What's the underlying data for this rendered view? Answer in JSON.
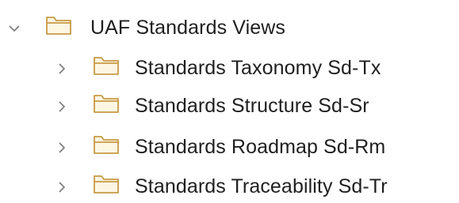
{
  "tree": {
    "root": {
      "label": "UAF Standards Views",
      "expanded": true,
      "icon": "folder-icon",
      "expand_icon": "chevron-down-icon"
    },
    "children": [
      {
        "label": "Standards Taxonomy Sd-Tx",
        "expanded": false,
        "icon": "folder-icon",
        "expand_icon": "chevron-right-icon"
      },
      {
        "label": "Standards Structure Sd-Sr",
        "expanded": false,
        "icon": "folder-icon",
        "expand_icon": "chevron-right-icon"
      },
      {
        "label": "Standards Roadmap Sd-Rm",
        "expanded": false,
        "icon": "folder-icon",
        "expand_icon": "chevron-right-icon"
      },
      {
        "label": "Standards Traceability Sd-Tr",
        "expanded": false,
        "icon": "folder-icon",
        "expand_icon": "chevron-right-icon"
      }
    ]
  },
  "colors": {
    "text": "#1f1f1f",
    "chevron": "#7a7a7a",
    "folder_stroke": "#c79a45",
    "folder_fill": "#fdf6e3"
  }
}
